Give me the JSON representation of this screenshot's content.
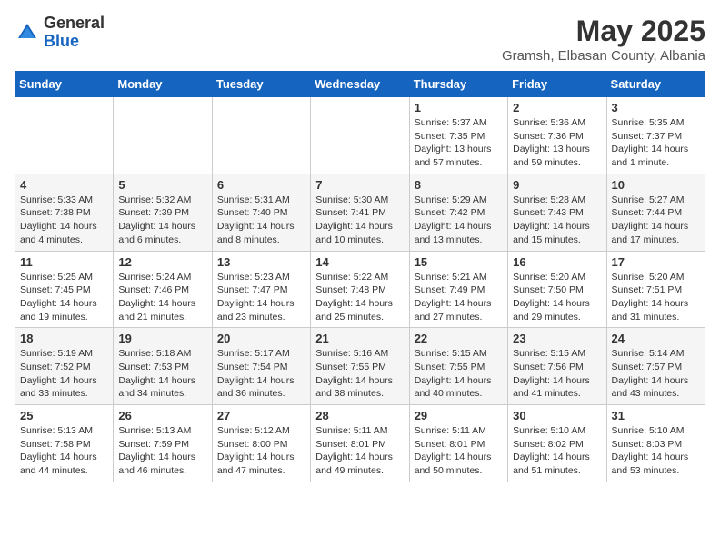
{
  "logo": {
    "general": "General",
    "blue": "Blue"
  },
  "header": {
    "month": "May 2025",
    "location": "Gramsh, Elbasan County, Albania"
  },
  "days_of_week": [
    "Sunday",
    "Monday",
    "Tuesday",
    "Wednesday",
    "Thursday",
    "Friday",
    "Saturday"
  ],
  "weeks": [
    [
      {
        "day": "",
        "info": ""
      },
      {
        "day": "",
        "info": ""
      },
      {
        "day": "",
        "info": ""
      },
      {
        "day": "",
        "info": ""
      },
      {
        "day": "1",
        "info": "Sunrise: 5:37 AM\nSunset: 7:35 PM\nDaylight: 13 hours and 57 minutes."
      },
      {
        "day": "2",
        "info": "Sunrise: 5:36 AM\nSunset: 7:36 PM\nDaylight: 13 hours and 59 minutes."
      },
      {
        "day": "3",
        "info": "Sunrise: 5:35 AM\nSunset: 7:37 PM\nDaylight: 14 hours and 1 minute."
      }
    ],
    [
      {
        "day": "4",
        "info": "Sunrise: 5:33 AM\nSunset: 7:38 PM\nDaylight: 14 hours and 4 minutes."
      },
      {
        "day": "5",
        "info": "Sunrise: 5:32 AM\nSunset: 7:39 PM\nDaylight: 14 hours and 6 minutes."
      },
      {
        "day": "6",
        "info": "Sunrise: 5:31 AM\nSunset: 7:40 PM\nDaylight: 14 hours and 8 minutes."
      },
      {
        "day": "7",
        "info": "Sunrise: 5:30 AM\nSunset: 7:41 PM\nDaylight: 14 hours and 10 minutes."
      },
      {
        "day": "8",
        "info": "Sunrise: 5:29 AM\nSunset: 7:42 PM\nDaylight: 14 hours and 13 minutes."
      },
      {
        "day": "9",
        "info": "Sunrise: 5:28 AM\nSunset: 7:43 PM\nDaylight: 14 hours and 15 minutes."
      },
      {
        "day": "10",
        "info": "Sunrise: 5:27 AM\nSunset: 7:44 PM\nDaylight: 14 hours and 17 minutes."
      }
    ],
    [
      {
        "day": "11",
        "info": "Sunrise: 5:25 AM\nSunset: 7:45 PM\nDaylight: 14 hours and 19 minutes."
      },
      {
        "day": "12",
        "info": "Sunrise: 5:24 AM\nSunset: 7:46 PM\nDaylight: 14 hours and 21 minutes."
      },
      {
        "day": "13",
        "info": "Sunrise: 5:23 AM\nSunset: 7:47 PM\nDaylight: 14 hours and 23 minutes."
      },
      {
        "day": "14",
        "info": "Sunrise: 5:22 AM\nSunset: 7:48 PM\nDaylight: 14 hours and 25 minutes."
      },
      {
        "day": "15",
        "info": "Sunrise: 5:21 AM\nSunset: 7:49 PM\nDaylight: 14 hours and 27 minutes."
      },
      {
        "day": "16",
        "info": "Sunrise: 5:20 AM\nSunset: 7:50 PM\nDaylight: 14 hours and 29 minutes."
      },
      {
        "day": "17",
        "info": "Sunrise: 5:20 AM\nSunset: 7:51 PM\nDaylight: 14 hours and 31 minutes."
      }
    ],
    [
      {
        "day": "18",
        "info": "Sunrise: 5:19 AM\nSunset: 7:52 PM\nDaylight: 14 hours and 33 minutes."
      },
      {
        "day": "19",
        "info": "Sunrise: 5:18 AM\nSunset: 7:53 PM\nDaylight: 14 hours and 34 minutes."
      },
      {
        "day": "20",
        "info": "Sunrise: 5:17 AM\nSunset: 7:54 PM\nDaylight: 14 hours and 36 minutes."
      },
      {
        "day": "21",
        "info": "Sunrise: 5:16 AM\nSunset: 7:55 PM\nDaylight: 14 hours and 38 minutes."
      },
      {
        "day": "22",
        "info": "Sunrise: 5:15 AM\nSunset: 7:55 PM\nDaylight: 14 hours and 40 minutes."
      },
      {
        "day": "23",
        "info": "Sunrise: 5:15 AM\nSunset: 7:56 PM\nDaylight: 14 hours and 41 minutes."
      },
      {
        "day": "24",
        "info": "Sunrise: 5:14 AM\nSunset: 7:57 PM\nDaylight: 14 hours and 43 minutes."
      }
    ],
    [
      {
        "day": "25",
        "info": "Sunrise: 5:13 AM\nSunset: 7:58 PM\nDaylight: 14 hours and 44 minutes."
      },
      {
        "day": "26",
        "info": "Sunrise: 5:13 AM\nSunset: 7:59 PM\nDaylight: 14 hours and 46 minutes."
      },
      {
        "day": "27",
        "info": "Sunrise: 5:12 AM\nSunset: 8:00 PM\nDaylight: 14 hours and 47 minutes."
      },
      {
        "day": "28",
        "info": "Sunrise: 5:11 AM\nSunset: 8:01 PM\nDaylight: 14 hours and 49 minutes."
      },
      {
        "day": "29",
        "info": "Sunrise: 5:11 AM\nSunset: 8:01 PM\nDaylight: 14 hours and 50 minutes."
      },
      {
        "day": "30",
        "info": "Sunrise: 5:10 AM\nSunset: 8:02 PM\nDaylight: 14 hours and 51 minutes."
      },
      {
        "day": "31",
        "info": "Sunrise: 5:10 AM\nSunset: 8:03 PM\nDaylight: 14 hours and 53 minutes."
      }
    ]
  ]
}
